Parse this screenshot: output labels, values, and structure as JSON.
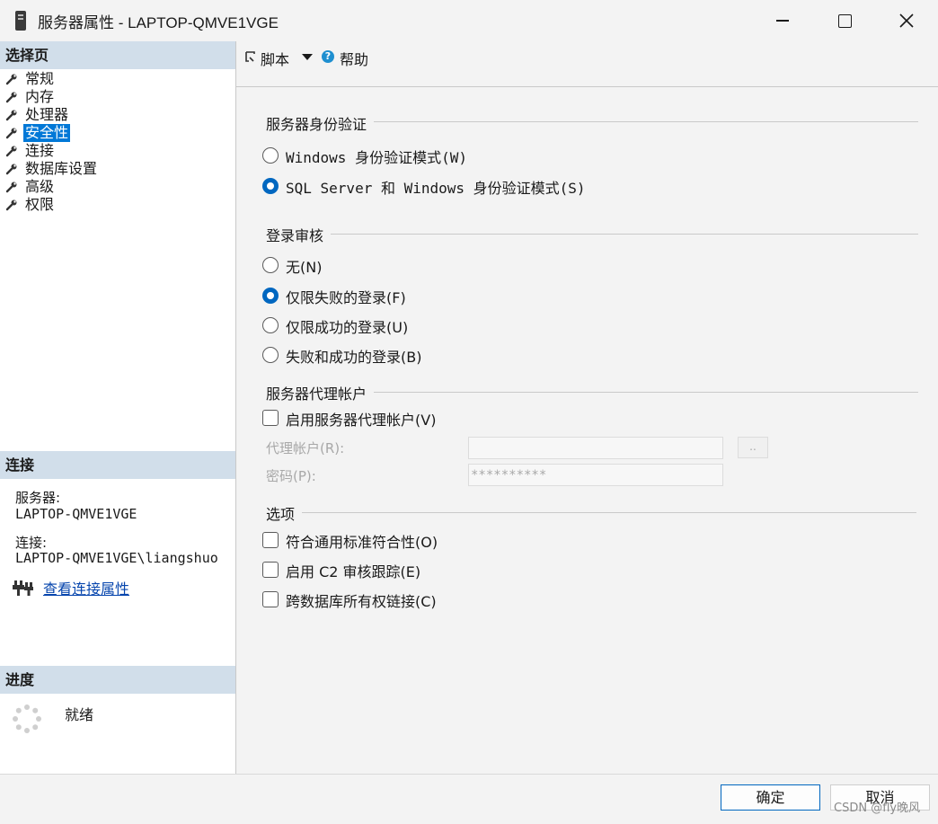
{
  "window": {
    "title": "服务器属性 - LAPTOP-QMVE1VGE",
    "controls": {
      "minimize": "minimize",
      "maximize": "maximize",
      "close": "close"
    }
  },
  "left": {
    "pages_header": "选择页",
    "pages": [
      {
        "label": "常规",
        "selected": false
      },
      {
        "label": "内存",
        "selected": false
      },
      {
        "label": "处理器",
        "selected": false
      },
      {
        "label": "安全性",
        "selected": true
      },
      {
        "label": "连接",
        "selected": false
      },
      {
        "label": "数据库设置",
        "selected": false
      },
      {
        "label": "高级",
        "selected": false
      },
      {
        "label": "权限",
        "selected": false
      }
    ],
    "connection_header": "连接",
    "server_label": "服务器:",
    "server_value": "LAPTOP-QMVE1VGE",
    "connection_label": "连接:",
    "connection_value": "LAPTOP-QMVE1VGE\\liangshuo",
    "view_connection_link": "查看连接属性",
    "progress_header": "进度",
    "progress_status": "就绪"
  },
  "toolbar": {
    "script_label": "脚本",
    "help_label": "帮助"
  },
  "security": {
    "auth_group_title": "服务器身份验证",
    "auth_options": [
      {
        "label": "Windows 身份验证模式(W)",
        "checked": false
      },
      {
        "label": "SQL Server 和 Windows 身份验证模式(S)",
        "checked": true
      }
    ],
    "audit_group_title": "登录审核",
    "audit_options": [
      {
        "label": "无(N)",
        "checked": false
      },
      {
        "label": "仅限失败的登录(F)",
        "checked": true
      },
      {
        "label": "仅限成功的登录(U)",
        "checked": false
      },
      {
        "label": "失败和成功的登录(B)",
        "checked": false
      }
    ],
    "proxy_group_title": "服务器代理帐户",
    "proxy_enable_label": "启用服务器代理帐户(V)",
    "proxy_account_label": "代理帐户(R):",
    "proxy_account_value": "",
    "browse_label": "..",
    "password_label": "密码(P):",
    "password_value": "**********",
    "options_group_title": "选项",
    "options": [
      {
        "label": "符合通用标准符合性(O)",
        "checked": false
      },
      {
        "label": "启用 C2 审核跟踪(E)",
        "checked": false
      },
      {
        "label": "跨数据库所有权链接(C)",
        "checked": false
      }
    ]
  },
  "buttons": {
    "ok": "确定",
    "cancel": "取消"
  },
  "watermark": "CSDN @fly晚风",
  "colors": {
    "accent": "#0067c0",
    "selection": "#0078d7",
    "section_header": "#d1deea",
    "link": "#0645ad"
  }
}
